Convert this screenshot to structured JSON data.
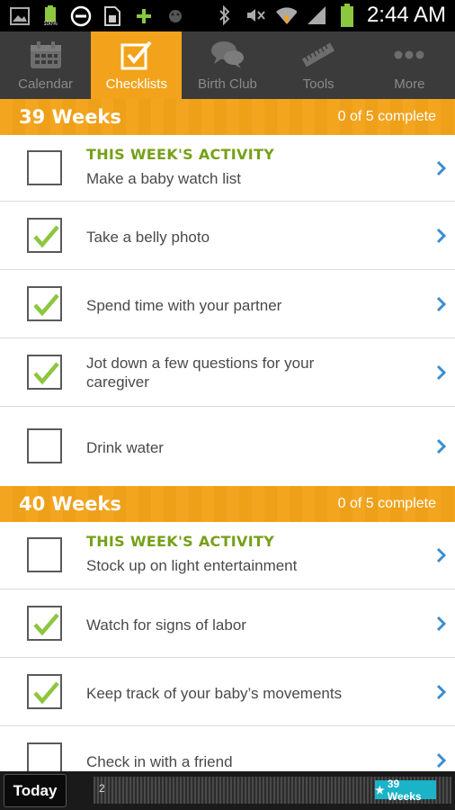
{
  "status_bar": {
    "time": "2:44 AM",
    "battery_small_label": "100%",
    "left_icons": [
      "image-icon",
      "battery-icon",
      "do-not-disturb-icon",
      "sim-card-icon",
      "plus-icon",
      "android-icon"
    ],
    "right_icons": [
      "bluetooth-icon",
      "mute-icon",
      "wifi-icon",
      "signal-icon",
      "battery-icon"
    ]
  },
  "tabs": [
    {
      "label": "Calendar",
      "icon": "calendar-icon",
      "active": false
    },
    {
      "label": "Checklists",
      "icon": "checklist-icon",
      "active": true
    },
    {
      "label": "Birth Club",
      "icon": "chat-bubbles-icon",
      "active": false
    },
    {
      "label": "Tools",
      "icon": "ruler-icon",
      "active": false
    },
    {
      "label": "More",
      "icon": "more-dots-icon",
      "active": false
    }
  ],
  "sections": [
    {
      "title": "39 Weeks",
      "count": "0 of 5 complete",
      "items": [
        {
          "kicker": "THIS WEEK'S ACTIVITY",
          "label": "Make a baby watch list",
          "checked": false
        },
        {
          "label": "Take a belly photo",
          "checked": true
        },
        {
          "label": "Spend time with your partner",
          "checked": true
        },
        {
          "label": "Jot down a few questions for your caregiver",
          "checked": true
        },
        {
          "label": "Drink water",
          "checked": false
        }
      ]
    },
    {
      "title": "40 Weeks",
      "count": "0 of 5 complete",
      "items": [
        {
          "kicker": "THIS WEEK'S ACTIVITY",
          "label": "Stock up on light entertainment",
          "checked": false
        },
        {
          "label": "Watch for signs of labor",
          "checked": true
        },
        {
          "label": "Keep track of your baby’s movements",
          "checked": true
        },
        {
          "label": "Check in with a friend",
          "checked": false
        }
      ]
    }
  ],
  "bottom_bar": {
    "today_label": "Today",
    "timeline_start": "2",
    "marker_label": "39 Weeks",
    "marker_icon": "star-icon"
  },
  "colors": {
    "accent_orange": "#f2a31b",
    "kicker_green": "#76a018",
    "check_green": "#8dc63f",
    "chevron_blue": "#3a8ed0",
    "marker_teal": "#1ab3c8"
  }
}
